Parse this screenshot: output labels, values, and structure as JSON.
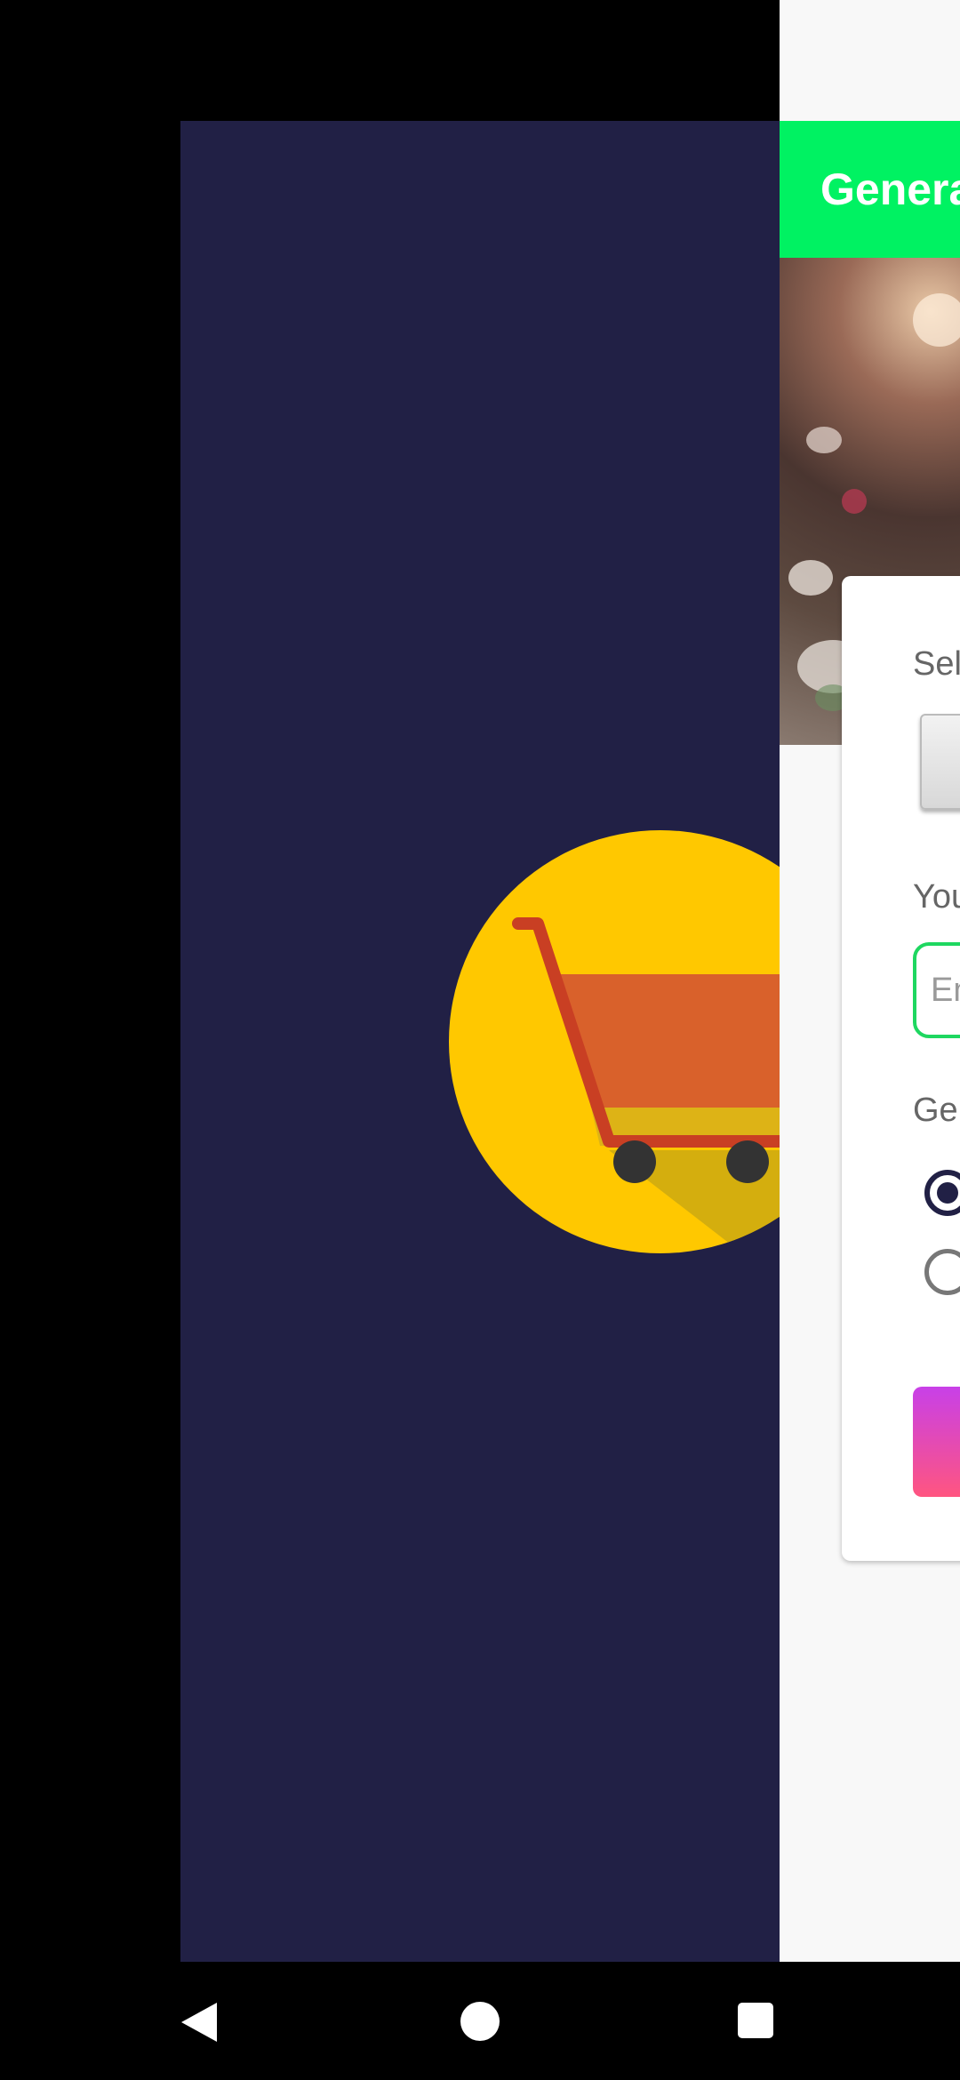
{
  "app": {
    "title": "Genera",
    "select_label": "Sel",
    "your_label": "You",
    "input_placeholder": "En",
    "gender_label": "Ger"
  },
  "colors": {
    "splash_bg": "#212045",
    "logo_circle": "#FFC800",
    "toolbar": "#00F262",
    "input_border": "#1ED760"
  },
  "icons": {
    "logo": "shopping-cart-icon",
    "back": "back-triangle-icon",
    "home": "home-circle-icon",
    "recents": "recents-square-icon"
  }
}
